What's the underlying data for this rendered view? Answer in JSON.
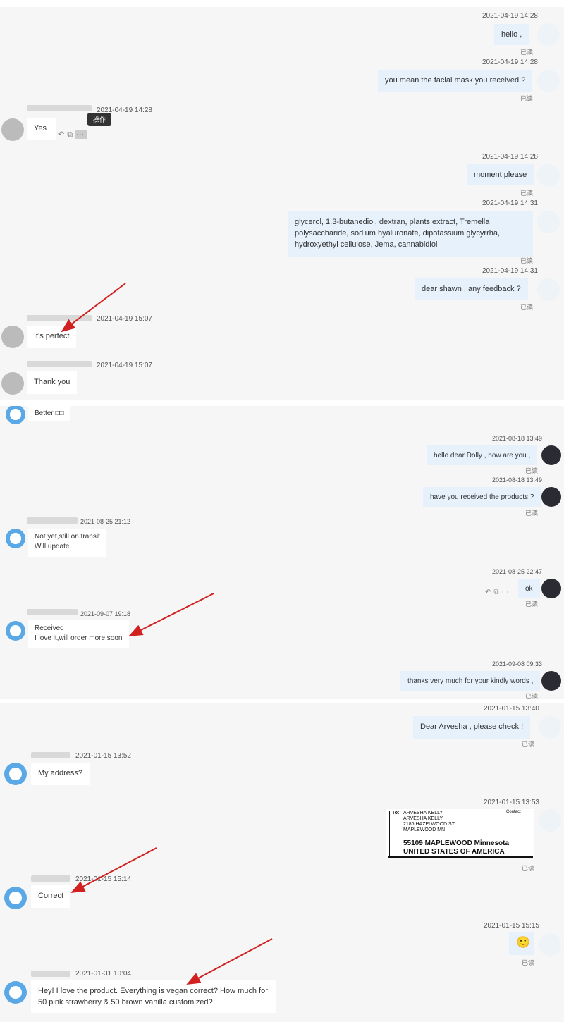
{
  "chat1": {
    "messages": [
      {
        "time": "2021-04-19 14:28",
        "text": "hello ,",
        "read": "已读"
      },
      {
        "time": "2021-04-19 14:28",
        "text": "you mean the facial mask you received ?",
        "read": "已读"
      },
      {
        "time": "2021-04-19 14:28",
        "text": "Yes",
        "tooltip": "操作"
      },
      {
        "time": "2021-04-19 14:28",
        "text": "moment please",
        "read": "已读"
      },
      {
        "time": "2021-04-19 14:31",
        "text": "glycerol, 1.3-butanediol, dextran, plants extract, Tremella polysaccharide, sodium hyaluronate, dipotassium glycyrrha, hydroxyethyl cellulose, Jema, cannabidiol",
        "read": "已读"
      },
      {
        "time": "2021-04-19 14:31",
        "text": "dear shawn , any feedback ?",
        "read": "已读"
      },
      {
        "time": "2021-04-19 15:07",
        "text": "It's perfect"
      },
      {
        "time": "2021-04-19 15:07",
        "text": "Thank you"
      }
    ]
  },
  "chat2": {
    "messages": [
      {
        "text": "Better □□"
      },
      {
        "time": "2021-08-18 13:49",
        "text": "hello dear Dolly , how are you ,",
        "read": "已读"
      },
      {
        "time": "2021-08-18 13:49",
        "text": "have you received the products ?",
        "read": "已读"
      },
      {
        "time": "2021-08-25 21:12",
        "line1": "Not yet,still on transit",
        "line2": "Will update"
      },
      {
        "time": "2021-08-25 22:47",
        "text": "ok",
        "read": "已读"
      },
      {
        "time": "2021-09-07 19:18",
        "line1": "Received",
        "line2": "I love it,will order more soon"
      },
      {
        "time": "2021-09-08 09:33",
        "text": "thanks very much for your kindly words ,",
        "read": "已读"
      }
    ]
  },
  "chat3": {
    "messages": [
      {
        "time": "2021-01-15 13:40",
        "text": "Dear Arvesha , please check !",
        "read": "已读"
      },
      {
        "time": "2021-01-15 13:52",
        "text": "My address?"
      },
      {
        "time": "2021-01-15 13:53",
        "read": "已读"
      },
      {
        "time": "2021-01-15 15:14",
        "text": "Correct"
      },
      {
        "time": "2021-01-15 15:15",
        "emoji": "🙂",
        "read": "已读"
      },
      {
        "time": "2021-01-31 10:04",
        "text": "Hey! I love the product. Everything is vegan correct? How much for 50 pink strawberry & 50 brown vanilla customized?"
      }
    ],
    "address_label": {
      "to": "To:",
      "contact": "Contact",
      "line1": "ARVESHA KELLY",
      "line2": "ARVESHA KELLY",
      "line3": "2186 HAZELWOOD ST",
      "line4": "MAPLEWOOD MN",
      "line5": "55109 MAPLEWOOD Minnesota",
      "line6": "UNITED STATES OF AMERICA"
    }
  },
  "icons": {
    "reply": "reply-icon",
    "quote": "quote-icon",
    "more": "more-icon"
  },
  "colors": {
    "outgoing_bubble": "#e6f1fc",
    "incoming_bubble": "#ffffff",
    "panel_bg": "#f6f6f7",
    "arrow": "#d0201f"
  }
}
